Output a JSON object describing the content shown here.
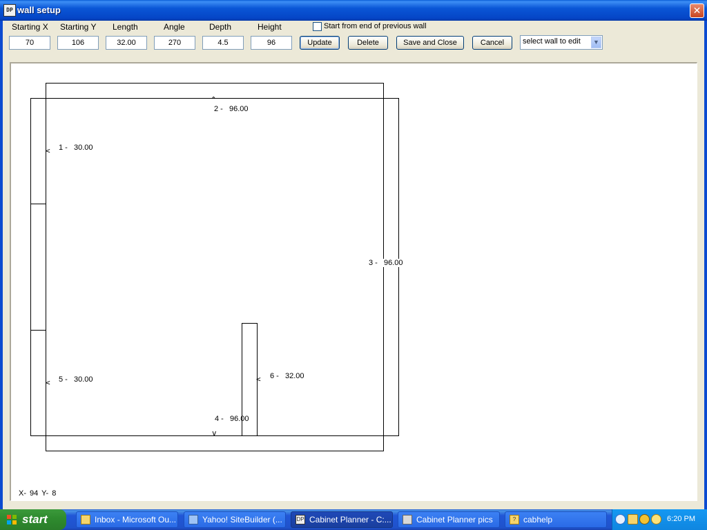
{
  "window": {
    "title": "wall setup",
    "app_icon_text": "DP",
    "close_glyph": "✕"
  },
  "toolbar": {
    "starting_x": {
      "label": "Starting X",
      "value": "70"
    },
    "starting_y": {
      "label": "Starting Y",
      "value": "106"
    },
    "length": {
      "label": "Length",
      "value": "32.00"
    },
    "angle": {
      "label": "Angle",
      "value": "270"
    },
    "depth": {
      "label": "Depth",
      "value": "4.5"
    },
    "height": {
      "label": "Height",
      "value": "96"
    },
    "start_from_end_label": "Start from end of previous wall",
    "start_from_end_checked": false,
    "update_label": "Update",
    "delete_label": "Delete",
    "save_close_label": "Save and Close",
    "cancel_label": "Cancel",
    "wall_select_value": "select wall to edit"
  },
  "canvas": {
    "walls": [
      {
        "number": "1",
        "length": "30.00",
        "label": "1 -   30.00"
      },
      {
        "number": "2",
        "length": "96.00",
        "label": "2 -   96.00"
      },
      {
        "number": "3",
        "length": "96.00",
        "label": "3 -   96.00"
      },
      {
        "number": "4",
        "length": "96.00",
        "label": "4 -   96.00"
      },
      {
        "number": "5",
        "length": "30.00",
        "label": "5 -   30.00"
      },
      {
        "number": "6",
        "length": "32.00",
        "label": "6 -   32.00"
      }
    ],
    "cursor_coords": "X-   94   Y-    8"
  },
  "taskbar": {
    "start_label": "start",
    "tasks": [
      {
        "label": "Inbox - Microsoft Ou..."
      },
      {
        "label": "Yahoo! SiteBuilder (..."
      },
      {
        "label": "Cabinet Planner - C:..."
      },
      {
        "label": "Cabinet Planner pics"
      },
      {
        "label": "cabhelp"
      }
    ],
    "active_task_index": 2,
    "clock": "6:20 PM"
  }
}
